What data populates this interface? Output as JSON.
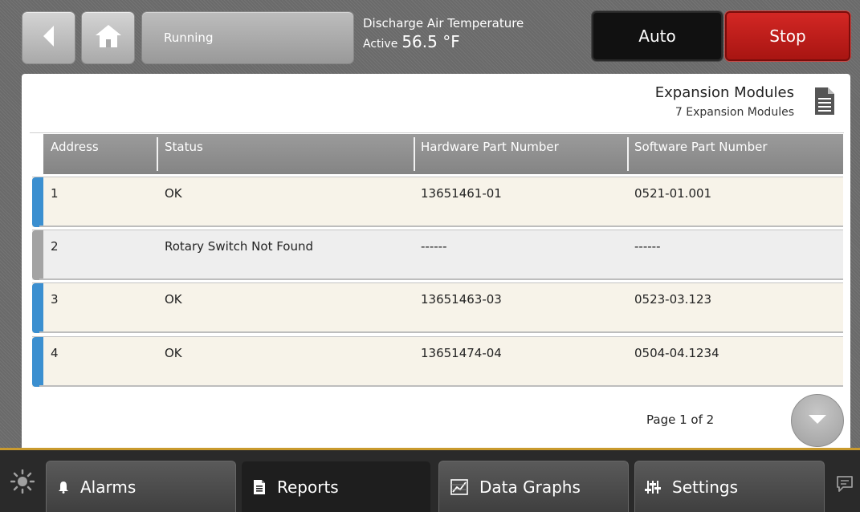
{
  "header": {
    "status": "Running",
    "temperature": {
      "title": "Discharge Air Temperature",
      "state": "Active",
      "value": "56.5 °F"
    },
    "auto_label": "Auto",
    "stop_label": "Stop"
  },
  "panel": {
    "title": "Expansion Modules",
    "subtitle": "7 Expansion Modules",
    "columns": [
      "Address",
      "Status",
      "Hardware Part Number",
      "Software Part Number"
    ],
    "rows": [
      {
        "address": "1",
        "status": "OK",
        "hardware": "13651461-01",
        "software": "0521-01.001",
        "state": "ok"
      },
      {
        "address": "2",
        "status": "Rotary Switch Not Found",
        "hardware": "------",
        "software": "------",
        "state": "missing"
      },
      {
        "address": "3",
        "status": "OK",
        "hardware": "13651463-03",
        "software": "0523-03.123",
        "state": "ok"
      },
      {
        "address": "4",
        "status": "OK",
        "hardware": "13651474-04",
        "software": "0504-04.1234",
        "state": "ok"
      }
    ],
    "page": "Page 1 of 2"
  },
  "nav": {
    "tabs": [
      {
        "label": "Alarms",
        "icon": "bell-icon"
      },
      {
        "label": "Reports",
        "icon": "document-icon"
      },
      {
        "label": "Data Graphs",
        "icon": "graph-icon"
      },
      {
        "label": "Settings",
        "icon": "sliders-icon"
      }
    ],
    "active_tab": "Reports"
  },
  "colors": {
    "ok_row_bg": "#f7f3e9",
    "missing_row_bg": "#eeeeee",
    "ok_marker": "#3b8fd0",
    "missing_marker": "#a3a3a3",
    "stop_red": "#c0201d",
    "accent_gold": "#c99a2e"
  }
}
